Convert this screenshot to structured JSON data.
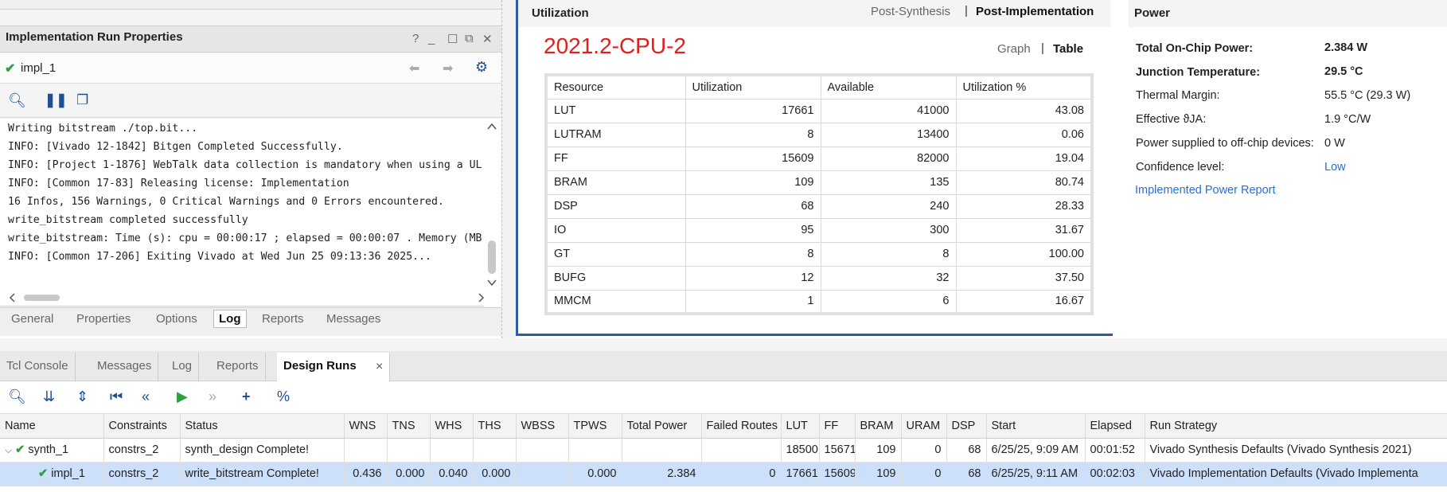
{
  "left_panel": {
    "title": "Implementation Run Properties",
    "run_name": "impl_1",
    "log_lines": [
      "Writing bitstream ./top.bit...",
      "INFO: [Vivado 12-1842] Bitgen Completed Successfully.",
      "INFO: [Project 1-1876] WebTalk data collection is mandatory when using a UL",
      "INFO: [Common 17-83] Releasing license: Implementation",
      "16 Infos, 156 Warnings, 0 Critical Warnings and 0 Errors encountered.",
      "write_bitstream completed successfully",
      "write_bitstream: Time (s): cpu = 00:00:17 ; elapsed = 00:00:07 . Memory (MB",
      "INFO: [Common 17-206] Exiting Vivado at Wed Jun 25 09:13:36 2025..."
    ],
    "tabs": [
      "General",
      "Properties",
      "Options",
      "Log",
      "Reports",
      "Messages"
    ],
    "active_tab": "Log"
  },
  "utilization": {
    "title": "Utilization",
    "view_tabs": [
      "Post-Synthesis",
      "Post-Implementation"
    ],
    "active_view": "Post-Implementation",
    "heading": "2021.2-CPU-2",
    "mode_tabs": [
      "Graph",
      "Table"
    ],
    "active_mode": "Table",
    "columns": [
      "Resource",
      "Utilization",
      "Available",
      "Utilization %"
    ],
    "rows": [
      [
        "LUT",
        "17661",
        "41000",
        "43.08"
      ],
      [
        "LUTRAM",
        "8",
        "13400",
        "0.06"
      ],
      [
        "FF",
        "15609",
        "82000",
        "19.04"
      ],
      [
        "BRAM",
        "109",
        "135",
        "80.74"
      ],
      [
        "DSP",
        "68",
        "240",
        "28.33"
      ],
      [
        "IO",
        "95",
        "300",
        "31.67"
      ],
      [
        "GT",
        "8",
        "8",
        "100.00"
      ],
      [
        "BUFG",
        "12",
        "32",
        "37.50"
      ],
      [
        "MMCM",
        "1",
        "6",
        "16.67"
      ]
    ]
  },
  "power": {
    "title": "Power",
    "items": [
      {
        "label": "Total On-Chip Power:",
        "value": "2.384 W",
        "bold": true
      },
      {
        "label": "Junction Temperature:",
        "value": "29.5 °C",
        "bold": true
      },
      {
        "label": "Thermal Margin:",
        "value": "55.5 °C (29.3 W)",
        "bold": false
      },
      {
        "label": "Effective ϑJA:",
        "value": "1.9 °C/W",
        "bold": false
      },
      {
        "label": "Power supplied to off-chip devices:",
        "value": "0 W",
        "bold": false
      },
      {
        "label": "Confidence level:",
        "value": "Low",
        "bold": false
      }
    ],
    "report_link": "Implemented Power Report"
  },
  "bottom": {
    "tabs": [
      "Tcl Console",
      "Messages",
      "Log",
      "Reports",
      "Design Runs"
    ],
    "active_tab": "Design Runs",
    "close_glyph": "×",
    "columns": [
      "Name",
      "Constraints",
      "Status",
      "WNS",
      "TNS",
      "WHS",
      "THS",
      "WBSS",
      "TPWS",
      "Total Power",
      "Failed Routes",
      "LUT",
      "FF",
      "BRAM",
      "URAM",
      "DSP",
      "Start",
      "Elapsed",
      "Run Strategy"
    ],
    "runs": [
      [
        "synth_1",
        "constrs_2",
        "synth_design Complete!",
        "",
        "",
        "",
        "",
        "",
        "",
        "",
        "",
        "18500",
        "15671",
        "109",
        "0",
        "68",
        "6/25/25, 9:09 AM",
        "00:01:52",
        "Vivado Synthesis Defaults (Vivado Synthesis 2021)"
      ],
      [
        "impl_1",
        "constrs_2",
        "write_bitstream Complete!",
        "0.436",
        "0.000",
        "0.040",
        "0.000",
        "",
        "0.000",
        "2.384",
        "0",
        "17661",
        "15609",
        "109",
        "0",
        "68",
        "6/25/25, 9:11 AM",
        "00:02:03",
        "Vivado Implementation Defaults (Vivado Implementa"
      ]
    ]
  },
  "colors": {
    "accent_blue": "#2f5aa8",
    "heading_red": "#e02020",
    "success_green": "#2e9e3e",
    "link_blue": "#2a6fd6",
    "selected_row": "#cde0fb"
  }
}
